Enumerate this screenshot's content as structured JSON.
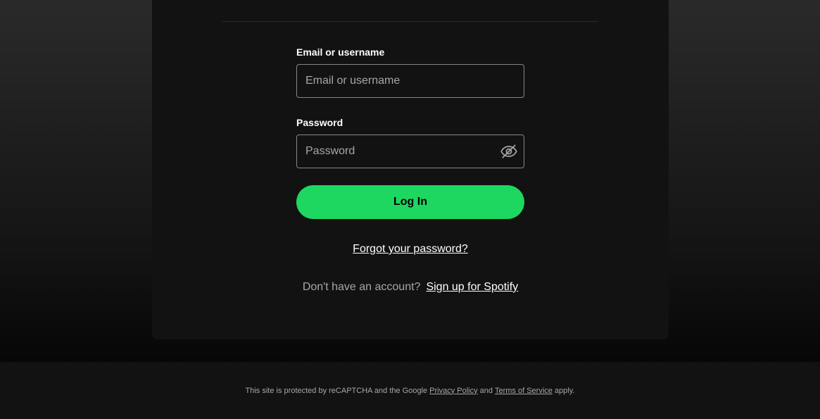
{
  "form": {
    "email_label": "Email or username",
    "email_placeholder": "Email or username",
    "email_value": "",
    "password_label": "Password",
    "password_placeholder": "Password",
    "password_value": "",
    "password_toggle_icon": "eye-slash-icon",
    "login_label": "Log In",
    "forgot_label": "Forgot your password?",
    "no_account_text": "Don't have an account?",
    "signup_label": "Sign up for Spotify"
  },
  "footer": {
    "prefix": "This site is protected by reCAPTCHA and the Google",
    "privacy_label": "Privacy Policy",
    "and_text": "and",
    "terms_label": "Terms of Service",
    "suffix": "apply."
  },
  "colors": {
    "accent": "#1ed760",
    "card_background": "#121212",
    "input_border": "#878787",
    "muted_text": "#a7a7a7"
  }
}
